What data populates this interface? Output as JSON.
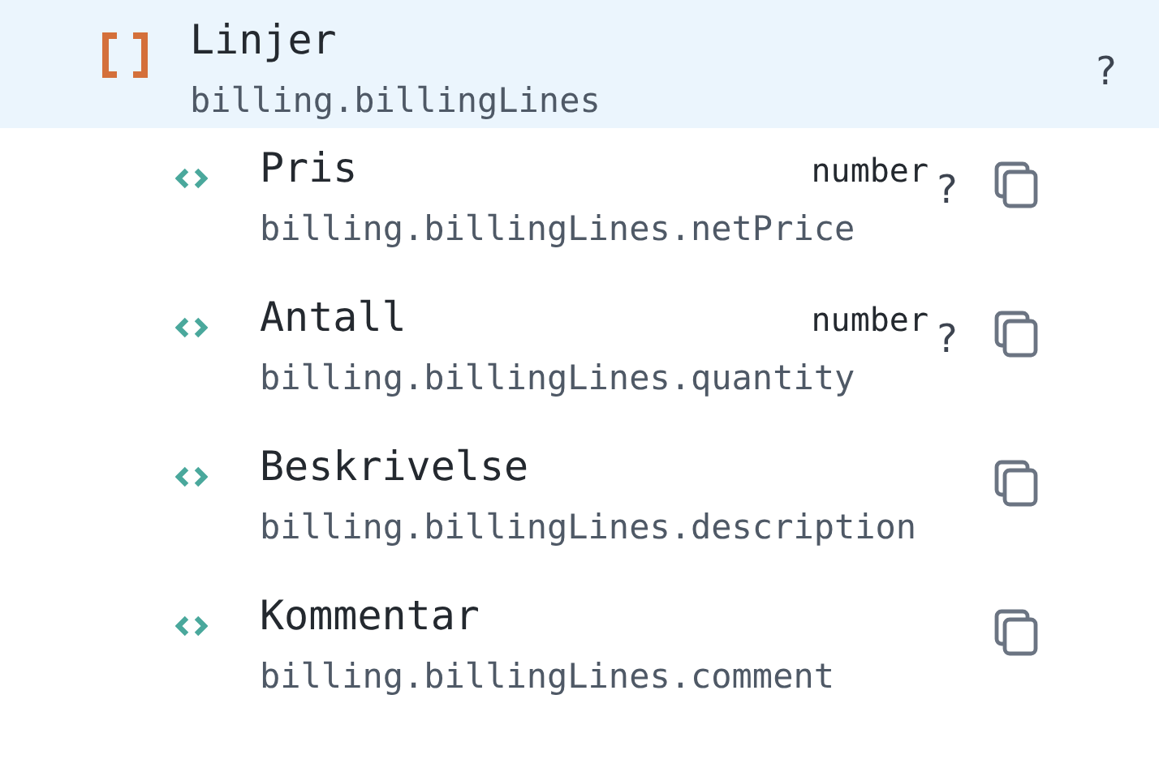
{
  "group": {
    "title": "Linjer",
    "path": "billing.billingLines",
    "help": "?",
    "selected": true
  },
  "fields": [
    {
      "title": "Pris",
      "type": "number",
      "path": "billing.billingLines.netPrice",
      "help": "?"
    },
    {
      "title": "Antall",
      "type": "number",
      "path": "billing.billingLines.quantity",
      "help": "?"
    },
    {
      "title": "Beskrivelse",
      "path": "billing.billingLines.description"
    },
    {
      "title": "Kommentar",
      "path": "billing.billingLines.comment"
    }
  ]
}
